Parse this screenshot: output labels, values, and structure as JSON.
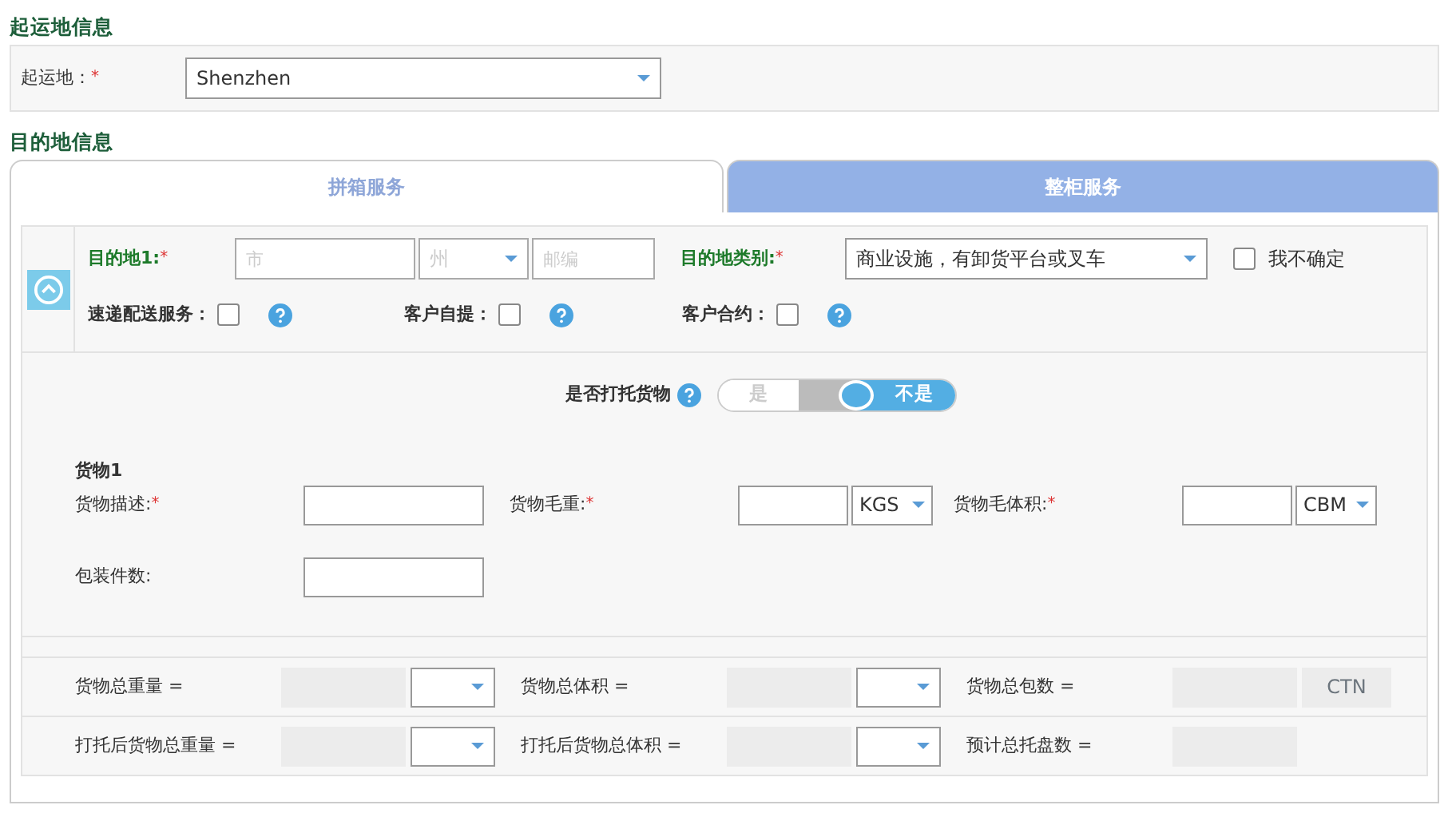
{
  "origin": {
    "heading": "起运地信息",
    "label": "起运地：",
    "required_mark": "*",
    "value": "Shenzhen"
  },
  "destination": {
    "heading": "目的地信息",
    "tabs": [
      {
        "label": "拼箱服务",
        "selected": true
      },
      {
        "label": "整柜服务",
        "selected": false
      }
    ],
    "dest1": {
      "label": "目的地1:",
      "required_mark": "*",
      "city_placeholder": "市",
      "state_placeholder": "州",
      "zip_placeholder": "邮编",
      "type_label": "目的地类别:",
      "type_required_mark": "*",
      "type_value": "商业设施，有卸货平台或叉车",
      "unsure": {
        "label": "我不确定",
        "checked": false
      }
    },
    "services": [
      {
        "label": "速递配送服务：",
        "checked": false
      },
      {
        "label": "客户自提：",
        "checked": false
      },
      {
        "label": "客户合约：",
        "checked": false
      }
    ],
    "palletized": {
      "label": "是否打托货物",
      "options": [
        {
          "label": "是",
          "selected": false
        },
        {
          "label": "不是",
          "selected": true
        }
      ]
    },
    "cargo": {
      "title": "货物1",
      "fields": [
        {
          "label": "货物描述:",
          "required_mark": "*",
          "kind": "text"
        },
        {
          "label": "货物毛重:",
          "required_mark": "*",
          "kind": "unit",
          "unit": "KGS"
        },
        {
          "label": "货物毛体积:",
          "required_mark": "*",
          "kind": "unit",
          "unit": "CBM"
        },
        {
          "label": "包装件数:",
          "kind": "text"
        }
      ]
    },
    "totals": [
      {
        "cells": [
          {
            "label": "货物总重量 =",
            "kind": "select"
          },
          {
            "label": "货物总体积 =",
            "kind": "select"
          },
          {
            "label": "货物总包数 =",
            "kind": "unit",
            "unit": "CTN"
          }
        ]
      },
      {
        "cells": [
          {
            "label": "打托后货物总重量 =",
            "kind": "select"
          },
          {
            "label": "打托后货物总体积 =",
            "kind": "select"
          },
          {
            "label": "预计总托盘数 =",
            "kind": "plain"
          }
        ]
      }
    ]
  }
}
